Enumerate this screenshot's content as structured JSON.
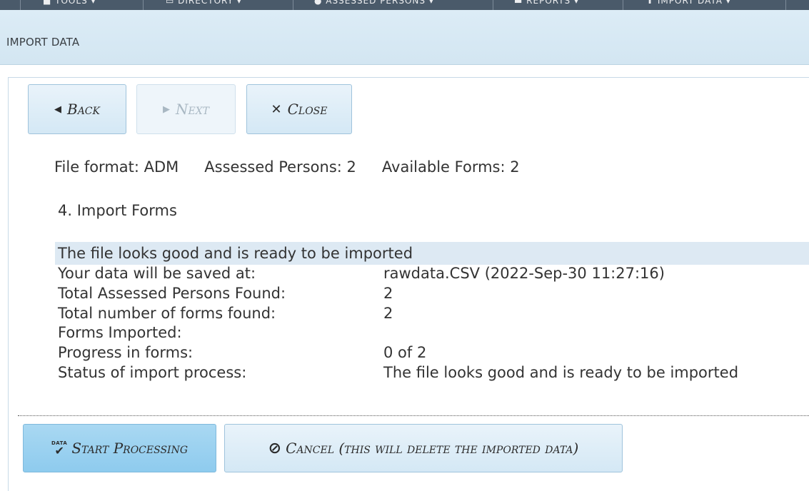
{
  "nav": {
    "items": [
      "TOOLS",
      "DIRECTORY",
      "ASSESSED PERSONS",
      "REPORTS",
      "IMPORT DATA"
    ]
  },
  "dialog": {
    "title": "IMPORT DATA"
  },
  "toolbar": {
    "back_label": "Back",
    "back_icon": "triangle-left-icon",
    "next_label": "Next",
    "next_icon": "triangle-right-icon",
    "next_disabled": true,
    "close_label": "Close",
    "close_icon": "close-icon"
  },
  "summary": {
    "file_format": "File format: ADM",
    "assessed_persons": "Assessed Persons: 2",
    "available_forms": "Available Forms: 2"
  },
  "step": {
    "title": "4. Import Forms"
  },
  "status_banner": "The file looks good and is ready to be imported",
  "details": [
    {
      "label": "Your data will be saved at:",
      "value": "rawdata.CSV (2022-Sep-30 11:27:16)"
    },
    {
      "label": "Total Assessed Persons Found:",
      "value": "2"
    },
    {
      "label": "Total number of forms found:",
      "value": "2"
    },
    {
      "label": "Forms Imported:",
      "value": ""
    },
    {
      "label": "Progress in forms:",
      "value": "0 of 2"
    },
    {
      "label": "Status of import process:",
      "value": "The file looks good and is ready to be imported"
    }
  ],
  "actions": {
    "start_label": "Start Processing",
    "start_icon_text": "DATA",
    "start_icon": "data-check-icon",
    "cancel_label": "Cancel (this will delete the imported data)",
    "cancel_icon": "ban-icon"
  },
  "colors": {
    "header_bg": "#d8eaf5",
    "button_bg": "#dcecf6",
    "primary_button_bg": "#9dd2f0",
    "status_band": "#dde9f3"
  }
}
